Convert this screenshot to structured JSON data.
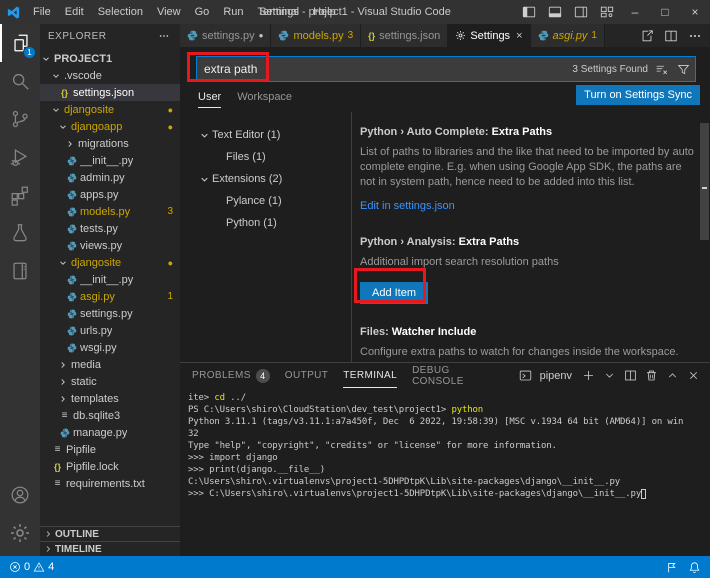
{
  "window": {
    "title": "Settings - project1 - Visual Studio Code",
    "controls": {
      "minimize": "–",
      "maximize": "□",
      "close": "×"
    }
  },
  "menus": [
    "File",
    "Edit",
    "Selection",
    "View",
    "Go",
    "Run",
    "Terminal",
    "Help"
  ],
  "activity_bar": {
    "items": [
      {
        "name": "explorer",
        "active": true,
        "badge": "1"
      },
      {
        "name": "search"
      },
      {
        "name": "source-control"
      },
      {
        "name": "run-and-debug"
      },
      {
        "name": "extensions"
      },
      {
        "name": "testing"
      },
      {
        "name": "notebook"
      }
    ],
    "bottom": [
      {
        "name": "account"
      },
      {
        "name": "settings-gear"
      }
    ]
  },
  "explorer": {
    "header": "EXPLORER",
    "root": "PROJECT1",
    "items": [
      {
        "label": ".vscode",
        "indent": 1,
        "chevron": "down"
      },
      {
        "label": "settings.json",
        "indent": 2,
        "icon": "json",
        "selected": true
      },
      {
        "label": "djangosite",
        "indent": 1,
        "chevron": "down",
        "modified": true,
        "dot": true
      },
      {
        "label": "djangoapp",
        "indent": 2,
        "chevron": "down",
        "modified": true,
        "dot": true
      },
      {
        "label": "migrations",
        "indent": 3,
        "chevron": "right"
      },
      {
        "label": "__init__.py",
        "indent": 3,
        "icon": "python"
      },
      {
        "label": "admin.py",
        "indent": 3,
        "icon": "python"
      },
      {
        "label": "apps.py",
        "indent": 3,
        "icon": "python"
      },
      {
        "label": "models.py",
        "indent": 3,
        "icon": "python",
        "modified": true,
        "badge": "3"
      },
      {
        "label": "tests.py",
        "indent": 3,
        "icon": "python"
      },
      {
        "label": "views.py",
        "indent": 3,
        "icon": "python"
      },
      {
        "label": "djangosite",
        "indent": 2,
        "chevron": "down",
        "modified": true,
        "dot": true
      },
      {
        "label": "__init__.py",
        "indent": 3,
        "icon": "python"
      },
      {
        "label": "asgi.py",
        "indent": 3,
        "icon": "python",
        "modified": true,
        "badge": "1"
      },
      {
        "label": "settings.py",
        "indent": 3,
        "icon": "python"
      },
      {
        "label": "urls.py",
        "indent": 3,
        "icon": "python"
      },
      {
        "label": "wsgi.py",
        "indent": 3,
        "icon": "python"
      },
      {
        "label": "media",
        "indent": 2,
        "chevron": "right"
      },
      {
        "label": "static",
        "indent": 2,
        "chevron": "right"
      },
      {
        "label": "templates",
        "indent": 2,
        "chevron": "right"
      },
      {
        "label": "db.sqlite3",
        "indent": 2,
        "icon": "lines"
      },
      {
        "label": "manage.py",
        "indent": 2,
        "icon": "python"
      },
      {
        "label": "Pipfile",
        "indent": 1,
        "icon": "lines"
      },
      {
        "label": "Pipfile.lock",
        "indent": 1,
        "icon": "json"
      },
      {
        "label": "requirements.txt",
        "indent": 1,
        "icon": "lines"
      }
    ],
    "sections": [
      "OUTLINE",
      "TIMELINE"
    ]
  },
  "tabs": [
    {
      "label": "settings.py",
      "icon": "python",
      "dot": true
    },
    {
      "label": "models.py",
      "icon": "python",
      "badge": "3",
      "modified_color": true
    },
    {
      "label": "settings.json",
      "icon": "json"
    },
    {
      "label": "Settings",
      "icon": "settings-gear",
      "active": true,
      "close": "×"
    },
    {
      "label": "asgi.py",
      "icon": "python",
      "badge": "1",
      "modified_color": true,
      "preview": true
    }
  ],
  "settings_editor": {
    "search": {
      "value": "extra path",
      "results": "3 Settings Found"
    },
    "scopes": [
      {
        "label": "User",
        "active": true
      },
      {
        "label": "Workspace"
      }
    ],
    "sync_button": "Turn on Settings Sync",
    "toc": [
      {
        "label": "Text Editor",
        "count": "(1)",
        "chevron": true
      },
      {
        "label": "Files",
        "count": "(1)",
        "child": true
      },
      {
        "label": "Extensions",
        "count": "(2)",
        "chevron": true
      },
      {
        "label": "Pylance",
        "count": "(1)",
        "child": true
      },
      {
        "label": "Python",
        "count": "(1)",
        "child": true
      }
    ],
    "entries": [
      {
        "category": "Python › Auto Complete: ",
        "name": "Extra Paths",
        "description": "List of paths to libraries and the like that need to be imported by auto complete engine. E.g. when using Google App SDK, the paths are not in system path, hence need to be added into this list.",
        "link": "Edit in settings.json"
      },
      {
        "category": "Python › Analysis: ",
        "name": "Extra Paths",
        "description": "Additional import search resolution paths",
        "button": "Add Item"
      },
      {
        "category": "Files: ",
        "name": "Watcher Include",
        "description": "Configure extra paths to watch for changes inside the workspace. By default, all workspace folders will be watched recursively, except for..."
      }
    ]
  },
  "panel": {
    "tabs": [
      {
        "label": "PROBLEMS",
        "badge": "4"
      },
      {
        "label": "OUTPUT"
      },
      {
        "label": "TERMINAL",
        "active": true
      },
      {
        "label": "DEBUG CONSOLE"
      }
    ],
    "shell_label": "pipenv",
    "terminal_lines": [
      [
        {
          "text": "ite> "
        },
        {
          "text": "cd",
          "color": "yellow"
        },
        {
          "text": " ../"
        }
      ],
      [
        {
          "text": "PS C:\\Users\\shiro\\CloudStation\\dev_test\\project1> "
        },
        {
          "text": "python",
          "color": "yellow"
        }
      ],
      [
        {
          "text": "Python 3.11.1 (tags/v3.11.1:a7a450f, Dec  6 2022, 19:58:39) [MSC v.1934 64 bit (AMD64)] on win"
        }
      ],
      [
        {
          "text": "32"
        }
      ],
      [
        {
          "text": "Type \"help\", \"copyright\", \"credits\" or \"license\" for more information."
        }
      ],
      [
        {
          "text": ">>> import django"
        }
      ],
      [
        {
          "text": ">>> print(django.__file__)"
        }
      ],
      [
        {
          "text": "C:\\Users\\shiro\\.virtualenvs\\project1-5DHPDtpK\\Lib\\site-packages\\django\\__init__.py"
        }
      ],
      [
        {
          "text": ">>> C:\\Users\\shiro\\.virtualenvs\\project1-5DHPDtpK\\Lib\\site-packages\\django\\__init__.py"
        },
        {
          "cursor": true
        }
      ]
    ]
  },
  "status_bar": {
    "errors": "0",
    "warnings": "4"
  },
  "colors": {
    "status_bar": "#007acc",
    "button_blue": "#1177bb",
    "link_blue": "#3794ff",
    "warning_yellow": "#cca700",
    "annotation_red": "#e8191c",
    "python_icon": "#519aba"
  }
}
